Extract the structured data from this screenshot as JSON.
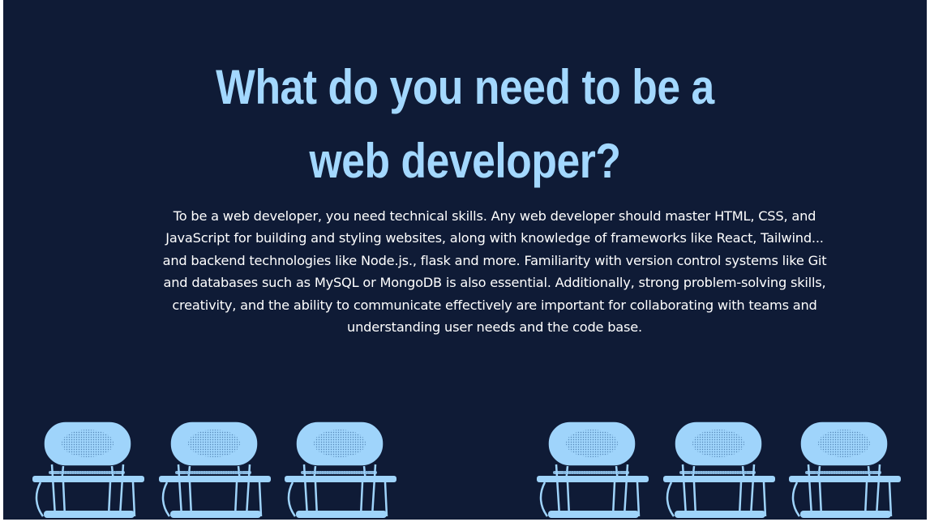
{
  "slide": {
    "title_line1": "What do you need to be a",
    "title_line2": "web developer?",
    "body": "To be a web developer, you need technical skills. Any web developer should master HTML, CSS, and JavaScript for building and styling websites, along with knowledge of frameworks like React, Tailwind... and backend technologies like Node.js., flask and more. Familiarity with version control systems like Git and databases such as MySQL or MongoDB is also essential. Additionally, strong problem-solving skills, creativity, and the ability to communicate effectively are important for collaborating with teams and understanding user needs and the code base."
  },
  "decoration": {
    "illustration": "chair-icon",
    "left_group_count": 3,
    "right_group_count": 3
  },
  "colors": {
    "background": "#0f1b36",
    "title": "#a3d8ff",
    "body_text": "#ffffff",
    "chair": "#9fd4fb"
  }
}
